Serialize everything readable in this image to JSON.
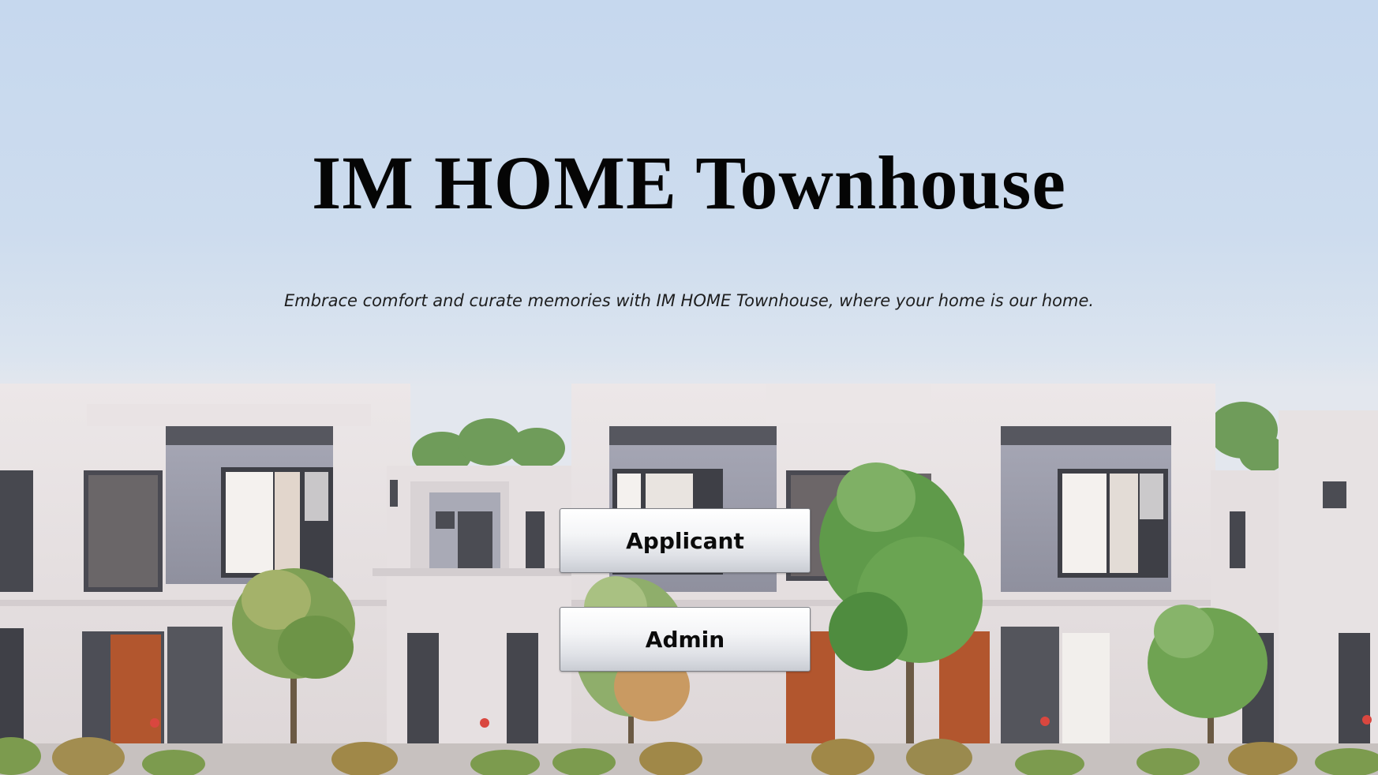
{
  "page": {
    "title": "IM HOME Townhouse",
    "tagline": "Embrace comfort and curate memories with IM HOME Townhouse, where your home is our home."
  },
  "actions": {
    "applicant_label": "Applicant",
    "admin_label": "Admin"
  },
  "colors": {
    "sky": "#c6d8ee",
    "wall": "#e7e1e2",
    "panel": "#9fa0ad",
    "window": "#4e4f56",
    "door": "#b2562e",
    "tree": "#5f9a4a",
    "title_text": "#050505"
  }
}
